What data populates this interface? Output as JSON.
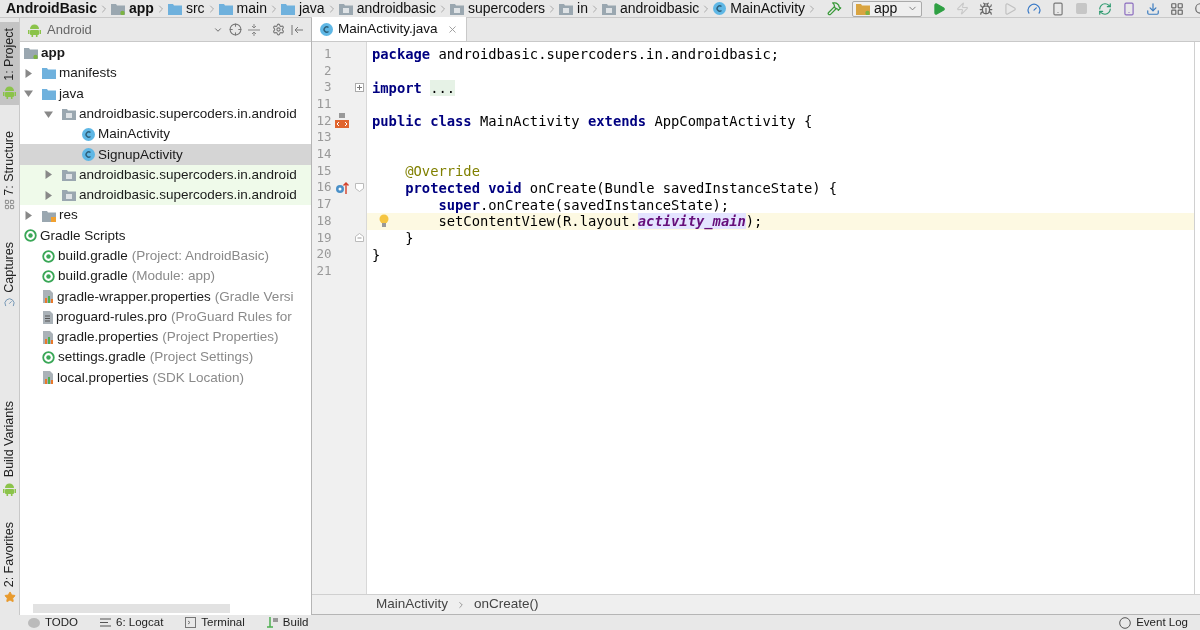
{
  "breadcrumb": [
    {
      "label": "AndroidBasic",
      "kind": "project"
    },
    {
      "label": "app",
      "kind": "module"
    },
    {
      "label": "src",
      "kind": "folder"
    },
    {
      "label": "main",
      "kind": "folder"
    },
    {
      "label": "java",
      "kind": "source"
    },
    {
      "label": "androidbasic",
      "kind": "package"
    },
    {
      "label": "supercoders",
      "kind": "package"
    },
    {
      "label": "in",
      "kind": "package"
    },
    {
      "label": "androidbasic",
      "kind": "package"
    },
    {
      "label": "MainActivity",
      "kind": "class"
    }
  ],
  "run_config": {
    "label": "app"
  },
  "left_stripe": {
    "top": [
      {
        "label": "1: Project",
        "kind": "android",
        "selected": true
      },
      {
        "label": "7: Structure",
        "kind": "structure",
        "selected": false
      },
      {
        "label": "Captures",
        "kind": "capture",
        "selected": false
      }
    ],
    "bottom": [
      {
        "label": "Build Variants",
        "kind": "android",
        "selected": false
      },
      {
        "label": "2: Favorites",
        "kind": "star",
        "selected": false
      }
    ]
  },
  "project_panel": {
    "view": "Android",
    "tree": [
      {
        "label": "app",
        "kind": "module",
        "selected": false,
        "children": [
          {
            "label": "manifests",
            "kind": "folder",
            "expanded": false,
            "selected": false
          },
          {
            "label": "java",
            "kind": "folder",
            "expanded": true,
            "selected": false,
            "children": [
              {
                "label": "androidbasic.supercoders.in.android",
                "kind": "package",
                "expanded": true,
                "selected": false,
                "children": [
                  {
                    "label": "MainActivity",
                    "kind": "class",
                    "selected": false
                  },
                  {
                    "label": "SignupActivity",
                    "kind": "class",
                    "selected": true
                  }
                ]
              },
              {
                "label": "androidbasic.supercoders.in.android",
                "kind": "package",
                "expanded": false,
                "selected": false,
                "test": true
              },
              {
                "label": "androidbasic.supercoders.in.android",
                "kind": "package",
                "expanded": false,
                "selected": false,
                "test": true
              }
            ]
          },
          {
            "label": "res",
            "kind": "res",
            "expanded": false,
            "selected": false
          }
        ]
      },
      {
        "label": "Gradle Scripts",
        "kind": "gradle",
        "selected": false,
        "children": [
          {
            "label": "build.gradle",
            "note": "(Project: AndroidBasic)",
            "kind": "gradle",
            "selected": false
          },
          {
            "label": "build.gradle",
            "note": "(Module: app)",
            "kind": "gradle",
            "selected": false
          },
          {
            "label": "gradle-wrapper.properties",
            "note": "(Gradle Versi",
            "kind": "properties",
            "selected": false
          },
          {
            "label": "proguard-rules.pro",
            "note": "(ProGuard Rules for",
            "kind": "text",
            "selected": false
          },
          {
            "label": "gradle.properties",
            "note": "(Project Properties)",
            "kind": "properties",
            "selected": false
          },
          {
            "label": "settings.gradle",
            "note": "(Project Settings)",
            "kind": "gradle",
            "selected": false
          },
          {
            "label": "local.properties",
            "note": "(SDK Location)",
            "kind": "properties",
            "selected": false
          }
        ]
      }
    ]
  },
  "editor": {
    "tabs": [
      {
        "label": "MainActivity.java",
        "selected": true
      }
    ],
    "lines": [
      {
        "number": "1",
        "kind": "plain",
        "selected": false,
        "tokens": [
          {
            "kind": "keyword",
            "text": "package"
          },
          {
            "kind": "plain",
            "text": " androidbasic.supercoders.in.androidbasic;"
          }
        ]
      },
      {
        "number": "2",
        "kind": "plain",
        "selected": false
      },
      {
        "number": "3",
        "kind": "import",
        "selected": false,
        "tokens": [
          {
            "kind": "keyword",
            "text": "import "
          },
          {
            "kind": "folded",
            "text": "..."
          }
        ]
      },
      {
        "number": "11",
        "kind": "plain",
        "selected": false
      },
      {
        "number": "12",
        "kind": "class",
        "selected": false,
        "tokens": [
          {
            "kind": "keyword",
            "text": "public class"
          },
          {
            "kind": "plain",
            "text": " MainActivity "
          },
          {
            "kind": "keyword",
            "text": "extends"
          },
          {
            "kind": "plain",
            "text": " AppCompatActivity {"
          }
        ]
      },
      {
        "number": "13",
        "kind": "plain",
        "selected": false
      },
      {
        "number": "14",
        "kind": "plain",
        "selected": false
      },
      {
        "number": "15",
        "kind": "plain",
        "selected": false,
        "tokens": [
          {
            "kind": "annotation",
            "text": "    @Override"
          }
        ]
      },
      {
        "number": "16",
        "kind": "method",
        "selected": false,
        "tokens": [
          {
            "kind": "keyword",
            "text": "    protected void"
          },
          {
            "kind": "plain",
            "text": " onCreate(Bundle savedInstanceState) {"
          }
        ]
      },
      {
        "number": "17",
        "kind": "plain",
        "selected": false,
        "tokens": [
          {
            "kind": "keyword",
            "text": "        super"
          },
          {
            "kind": "plain",
            "text": ".onCreate(savedInstanceState);"
          }
        ]
      },
      {
        "number": "18",
        "kind": "plain",
        "selected": true,
        "bulb": true,
        "tokens": [
          {
            "kind": "plain",
            "text": "        setContentView(R.layout."
          },
          {
            "kind": "field",
            "text": "activity_main"
          },
          {
            "kind": "plain",
            "text": ");"
          }
        ]
      },
      {
        "number": "19",
        "kind": "block-end",
        "selected": false,
        "tokens": [
          {
            "kind": "plain",
            "text": "    }"
          }
        ]
      },
      {
        "number": "20",
        "kind": "plain",
        "selected": false,
        "tokens": [
          {
            "kind": "plain",
            "text": "}"
          }
        ]
      },
      {
        "number": "21",
        "kind": "plain",
        "selected": false
      }
    ],
    "breadcrumb": [
      "MainActivity",
      "onCreate()"
    ]
  },
  "tool_windows": {
    "left": [
      {
        "label": "TODO",
        "kind": "todo"
      },
      {
        "label": "6: Logcat",
        "kind": "logcat"
      },
      {
        "label": "Terminal",
        "kind": "terminal"
      },
      {
        "label": "Build",
        "kind": "build"
      }
    ],
    "right": [
      {
        "label": "Event Log",
        "kind": "balloon"
      }
    ]
  }
}
